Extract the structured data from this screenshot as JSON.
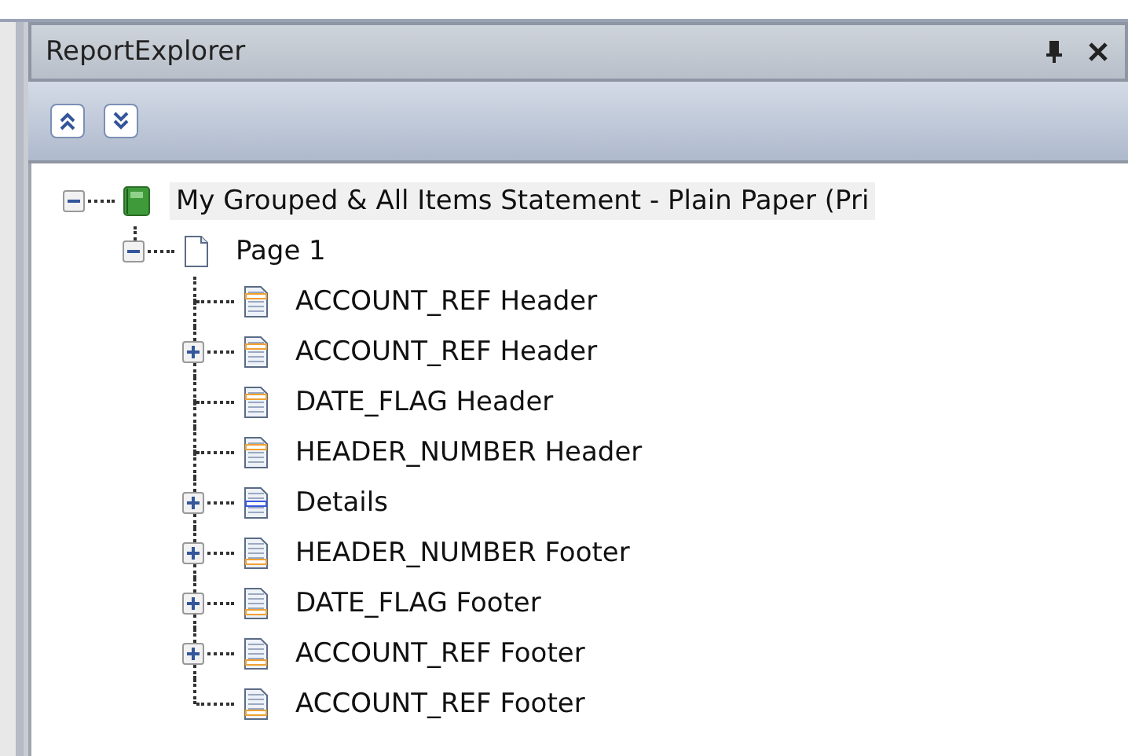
{
  "panel": {
    "title": "ReportExplorer"
  },
  "tree": [
    {
      "label": "My Grouped & All Items Statement - Plain Paper (Pri",
      "kind": "report",
      "expanded": true,
      "selected": true,
      "children": [
        {
          "label": "Page 1",
          "kind": "page",
          "expanded": true,
          "selected": false,
          "children": [
            {
              "label": "ACCOUNT_REF Header",
              "kind": "header",
              "selected": false
            },
            {
              "label": "ACCOUNT_REF Header",
              "kind": "header",
              "expanded": false,
              "selected": false
            },
            {
              "label": "DATE_FLAG Header",
              "kind": "header",
              "selected": false
            },
            {
              "label": "HEADER_NUMBER Header",
              "kind": "header",
              "selected": false
            },
            {
              "label": "Details",
              "kind": "detail",
              "expanded": false,
              "selected": false
            },
            {
              "label": "HEADER_NUMBER Footer",
              "kind": "footer",
              "expanded": false,
              "selected": false
            },
            {
              "label": "DATE_FLAG Footer",
              "kind": "footer",
              "expanded": false,
              "selected": false
            },
            {
              "label": "ACCOUNT_REF Footer",
              "kind": "footer",
              "expanded": false,
              "selected": false
            },
            {
              "label": "ACCOUNT_REF Footer",
              "kind": "footer",
              "selected": false
            }
          ]
        }
      ]
    }
  ]
}
